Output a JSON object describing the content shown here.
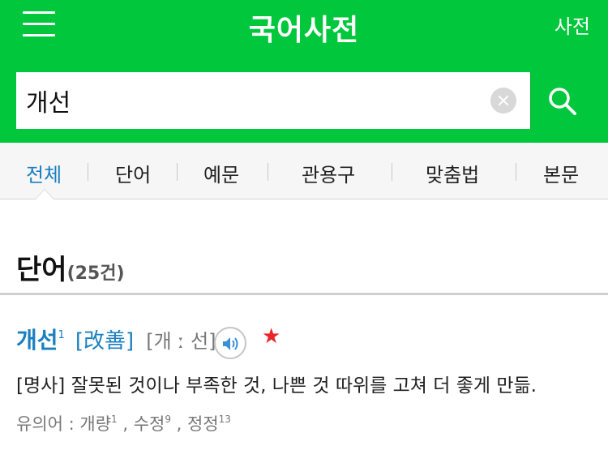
{
  "header": {
    "title": "국어사전",
    "dict_link": "사전",
    "menu_icon": "hamburger-menu-icon"
  },
  "search": {
    "value": "개선",
    "clear_icon": "clear-x-icon",
    "search_icon": "magnifier-icon"
  },
  "tabs": [
    {
      "label": "전체",
      "active": true
    },
    {
      "label": "단어",
      "active": false
    },
    {
      "label": "예문",
      "active": false
    },
    {
      "label": "관용구",
      "active": false
    },
    {
      "label": "맞춤법",
      "active": false
    },
    {
      "label": "본문",
      "active": false
    }
  ],
  "section": {
    "title": "단어",
    "count": "(25건)"
  },
  "entry": {
    "word": "개선",
    "word_sup": "1",
    "hanja": "[改善]",
    "pronunciation": "[개 ː 선]",
    "speaker_icon": "speaker-icon",
    "star_icon": "star-icon",
    "definition": "[명사] 잘못된 것이나 부족한 것, 나쁜 것 따위를 고쳐 더 좋게 만듦.",
    "synonym_label": "유의어 : ",
    "synonyms": [
      {
        "word": "개량",
        "sup": "1",
        "sep": " , "
      },
      {
        "word": "수정",
        "sup": "9",
        "sep": " , "
      },
      {
        "word": "정정",
        "sup": "13",
        "sep": ""
      }
    ]
  },
  "colors": {
    "brand_green": "#00c73c",
    "link_blue": "#1a7fc1",
    "star_red": "#e8262a"
  }
}
